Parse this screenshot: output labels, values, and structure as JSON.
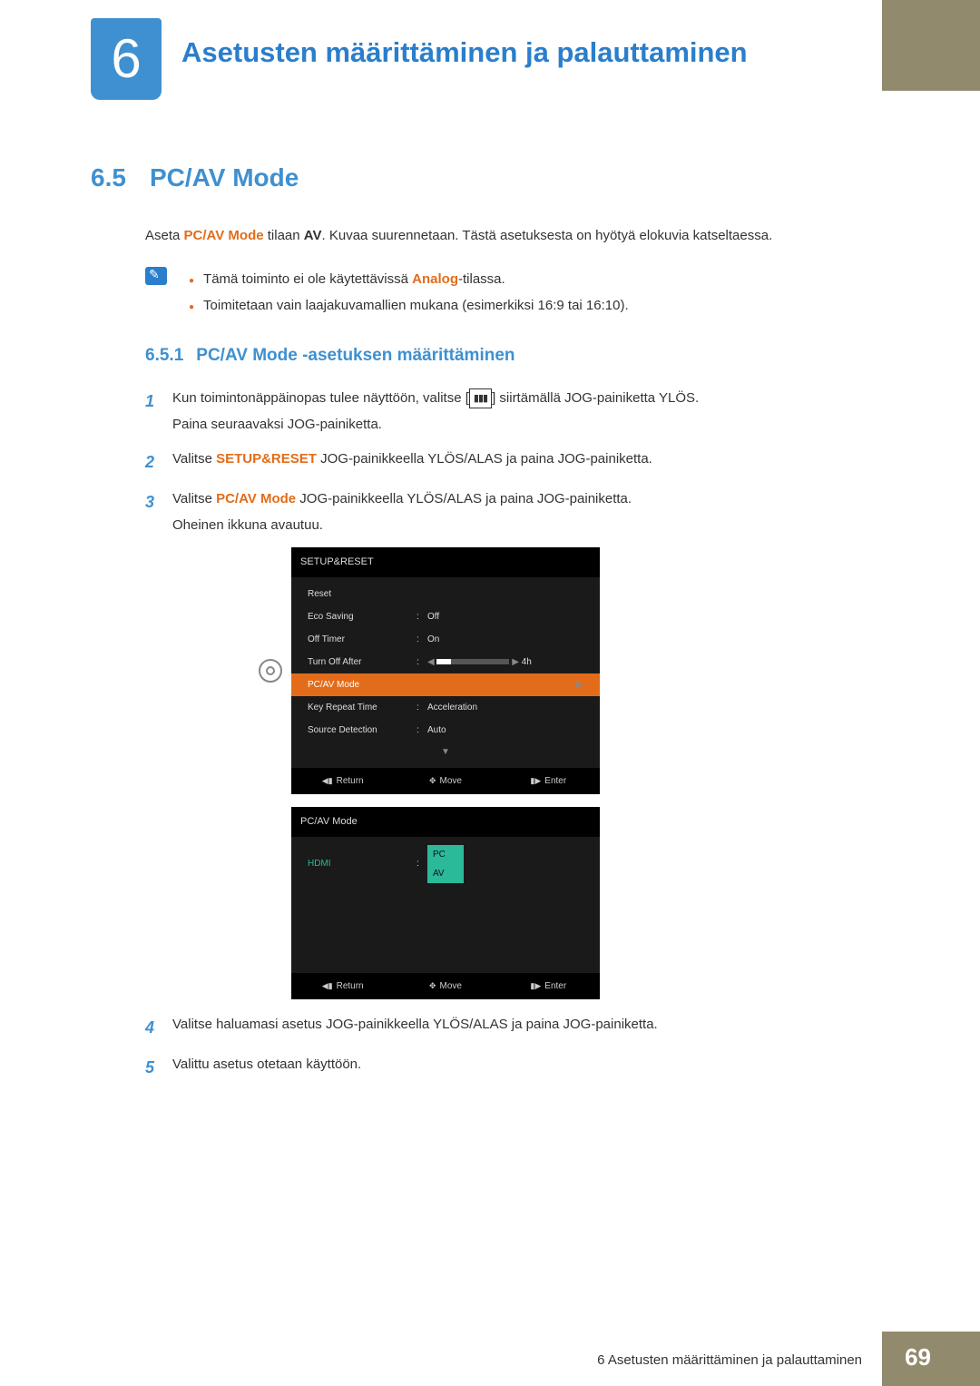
{
  "chapter": {
    "number": "6",
    "title": "Asetusten määrittäminen ja palauttaminen"
  },
  "section": {
    "number": "6.5",
    "title": "PC/AV Mode"
  },
  "intro": {
    "prefix": "Aseta ",
    "bold1": "PC/AV Mode",
    "mid": " tilaan ",
    "bold2": "AV",
    "rest": ". Kuvaa suurennetaan. Tästä asetuksesta on hyötyä elokuvia katseltaessa."
  },
  "notes": {
    "item1_pre": "Tämä toiminto ei ole käytettävissä ",
    "item1_bold": "Analog",
    "item1_post": "-tilassa.",
    "item2": "Toimitetaan vain laajakuvamallien mukana (esimerkiksi 16:9 tai 16:10)."
  },
  "subsection": {
    "number": "6.5.1",
    "title": "PC/AV Mode -asetuksen määrittäminen"
  },
  "steps": {
    "s1a": "Kun toimintonäppäinopas tulee näyttöön, valitse [",
    "s1b": "] siirtämällä JOG-painiketta YLÖS.",
    "s1c": "Paina seuraavaksi JOG-painiketta.",
    "s2a": "Valitse ",
    "s2bold": "SETUP&RESET",
    "s2b": " JOG-painikkeella YLÖS/ALAS ja paina JOG-painiketta.",
    "s3a": "Valitse ",
    "s3bold": "PC/AV Mode",
    "s3b": " JOG-painikkeella YLÖS/ALAS ja paina JOG-painiketta.",
    "s3c": "Oheinen ikkuna avautuu.",
    "s4": "Valitse haluamasi asetus JOG-painikkeella YLÖS/ALAS ja paina JOG-painiketta.",
    "s5": "Valittu asetus otetaan käyttöön."
  },
  "osd1": {
    "title": "SETUP&RESET",
    "items": {
      "reset": "Reset",
      "eco": "Eco Saving",
      "eco_val": "Off",
      "timer": "Off Timer",
      "timer_val": "On",
      "turnoff": "Turn Off After",
      "turnoff_val": "4h",
      "pcav": "PC/AV Mode",
      "keyrep": "Key Repeat Time",
      "keyrep_val": "Acceleration",
      "srcdet": "Source Detection",
      "srcdet_val": "Auto"
    }
  },
  "osd2": {
    "title": "PC/AV Mode",
    "hdmi": "HDMI",
    "opt_pc": "PC",
    "opt_av": "AV"
  },
  "osd_footer": {
    "return": "Return",
    "move": "Move",
    "enter": "Enter"
  },
  "footer": {
    "text": "6 Asetusten määrittäminen ja palauttaminen",
    "page": "69"
  },
  "nums": {
    "n1": "1",
    "n2": "2",
    "n3": "3",
    "n4": "4",
    "n5": "5"
  }
}
